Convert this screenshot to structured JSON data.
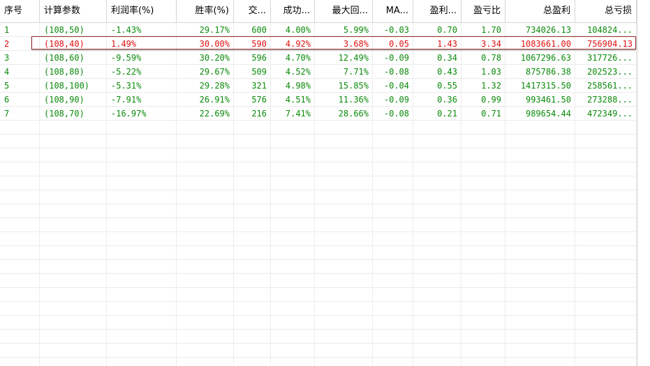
{
  "colors": {
    "normal_row": "#0a8a0a",
    "selected_row": "#e01010",
    "header_text": "#000000",
    "grid_line": "#ececec"
  },
  "columns": [
    {
      "key": "idx",
      "label": "序号",
      "align": "left"
    },
    {
      "key": "param",
      "label": "计算参数",
      "align": "left"
    },
    {
      "key": "profit_rate",
      "label": "利润率(%)",
      "align": "left"
    },
    {
      "key": "win_rate",
      "label": "胜率(%)",
      "align": "right"
    },
    {
      "key": "trades",
      "label": "交...",
      "align": "right"
    },
    {
      "key": "success",
      "label": "成功...",
      "align": "right"
    },
    {
      "key": "max_dd",
      "label": "最大回...",
      "align": "right"
    },
    {
      "key": "ma",
      "label": "MA...",
      "align": "right"
    },
    {
      "key": "pl",
      "label": "盈利...",
      "align": "right"
    },
    {
      "key": "plr",
      "label": "盈亏比",
      "align": "right"
    },
    {
      "key": "total_profit",
      "label": "总盈利",
      "align": "right"
    },
    {
      "key": "total_loss",
      "label": "总亏损",
      "align": "right"
    }
  ],
  "rows": [
    {
      "selected": false,
      "cells": [
        "1",
        "(108,50)",
        "-1.43%",
        "29.17%",
        "600",
        "4.00%",
        "5.99%",
        "-0.03",
        "0.70",
        "1.70",
        "734026.13",
        "104824..."
      ]
    },
    {
      "selected": true,
      "cells": [
        "2",
        "(108,40)",
        "1.49%",
        "30.00%",
        "590",
        "4.92%",
        "3.68%",
        "0.05",
        "1.43",
        "3.34",
        "1083661.00",
        "756904.13"
      ]
    },
    {
      "selected": false,
      "cells": [
        "3",
        "(108,60)",
        "-9.59%",
        "30.20%",
        "596",
        "4.70%",
        "12.49%",
        "-0.09",
        "0.34",
        "0.78",
        "1067296.63",
        "317726..."
      ]
    },
    {
      "selected": false,
      "cells": [
        "4",
        "(108,80)",
        "-5.22%",
        "29.67%",
        "509",
        "4.52%",
        "7.71%",
        "-0.08",
        "0.43",
        "1.03",
        "875786.38",
        "202523..."
      ]
    },
    {
      "selected": false,
      "cells": [
        "5",
        "(108,100)",
        "-5.31%",
        "29.28%",
        "321",
        "4.98%",
        "15.85%",
        "-0.04",
        "0.55",
        "1.32",
        "1417315.50",
        "258561..."
      ]
    },
    {
      "selected": false,
      "cells": [
        "6",
        "(108,90)",
        "-7.91%",
        "26.91%",
        "576",
        "4.51%",
        "11.36%",
        "-0.09",
        "0.36",
        "0.99",
        "993461.50",
        "273288..."
      ]
    },
    {
      "selected": false,
      "cells": [
        "7",
        "(108,70)",
        "-16.97%",
        "22.69%",
        "216",
        "7.41%",
        "28.66%",
        "-0.08",
        "0.21",
        "0.71",
        "989654.44",
        "472349..."
      ]
    }
  ]
}
